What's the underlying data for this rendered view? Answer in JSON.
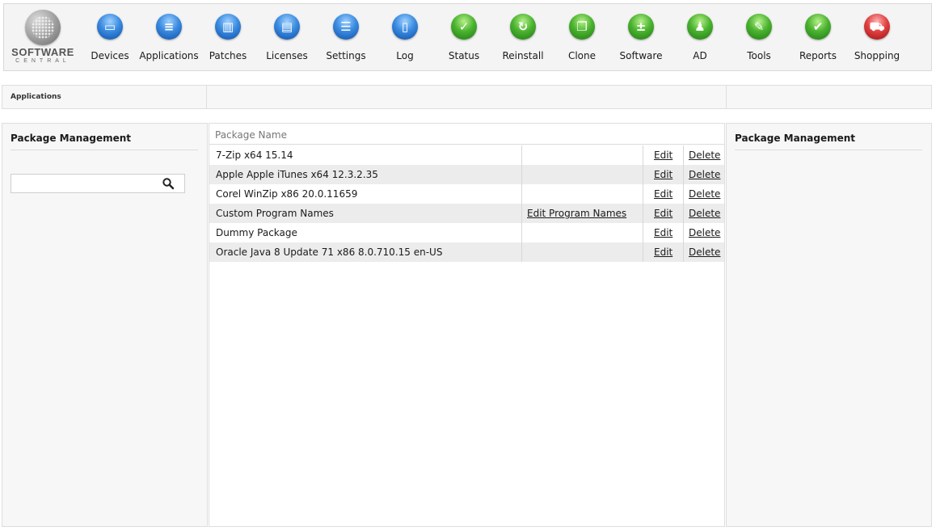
{
  "logo": {
    "line1": "SOFTWARE",
    "line2": "CENTRAL"
  },
  "nav": [
    {
      "label": "Devices",
      "icon": "monitor-icon",
      "color": "blue",
      "glyph": "▭"
    },
    {
      "label": "Applications",
      "icon": "applications-icon",
      "color": "blue",
      "glyph": "≡"
    },
    {
      "label": "Patches",
      "icon": "patches-icon",
      "color": "blue",
      "glyph": "▥"
    },
    {
      "label": "Licenses",
      "icon": "licenses-icon",
      "color": "blue",
      "glyph": "▤"
    },
    {
      "label": "Settings",
      "icon": "settings-icon",
      "color": "blue",
      "glyph": "☰"
    },
    {
      "label": "Log",
      "icon": "log-icon",
      "color": "blue",
      "glyph": "▯"
    },
    {
      "label": "Status",
      "icon": "status-check-icon",
      "color": "green",
      "glyph": "✓"
    },
    {
      "label": "Reinstall",
      "icon": "reinstall-icon",
      "color": "green",
      "glyph": "↻"
    },
    {
      "label": "Clone",
      "icon": "clone-icon",
      "color": "green",
      "glyph": "❐"
    },
    {
      "label": "Software",
      "icon": "software-icon",
      "color": "green",
      "glyph": "±"
    },
    {
      "label": "AD",
      "icon": "ad-users-icon",
      "color": "green",
      "glyph": "♟"
    },
    {
      "label": "Tools",
      "icon": "tools-wrench-icon",
      "color": "green",
      "glyph": "✎"
    },
    {
      "label": "Reports",
      "icon": "reports-icon",
      "color": "green",
      "glyph": "✔"
    },
    {
      "label": "Shopping",
      "icon": "shopping-cart-icon",
      "color": "red",
      "glyph": "⛟"
    }
  ],
  "breadcrumb": "Applications",
  "left_panel": {
    "title": "Package Management",
    "search_placeholder": "",
    "search_value": ""
  },
  "right_panel": {
    "title": "Package Management"
  },
  "table": {
    "header": "Package Name",
    "rows": [
      {
        "name": "7-Zip x64 15.14",
        "extra": "",
        "edit": "Edit",
        "delete": "Delete"
      },
      {
        "name": "Apple Apple iTunes x64 12.3.2.35",
        "extra": "",
        "edit": "Edit",
        "delete": "Delete"
      },
      {
        "name": "Corel WinZip x86 20.0.11659",
        "extra": "",
        "edit": "Edit",
        "delete": "Delete"
      },
      {
        "name": "Custom Program Names",
        "extra": "Edit Program Names",
        "edit": "Edit",
        "delete": "Delete"
      },
      {
        "name": "Dummy Package",
        "extra": "",
        "edit": "Edit",
        "delete": "Delete"
      },
      {
        "name": "Oracle Java 8 Update 71 x86 8.0.710.15 en-US",
        "extra": "",
        "edit": "Edit",
        "delete": "Delete"
      }
    ]
  },
  "colors": {
    "toolbar_bg": "#f4f4f4",
    "row_alt": "#ececec",
    "nav_blue": "#3a8be0",
    "nav_green": "#4bb330",
    "nav_red": "#e04040"
  }
}
